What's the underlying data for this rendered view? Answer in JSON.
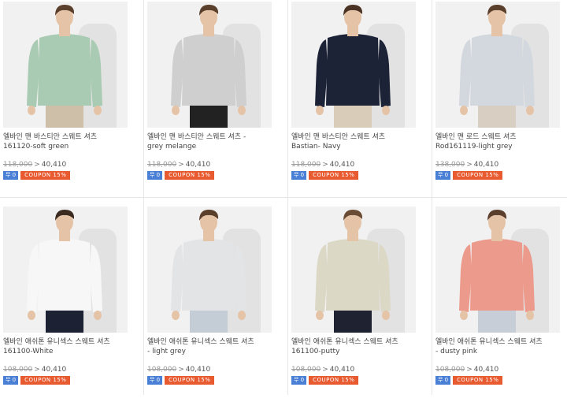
{
  "products": [
    {
      "title_lines": [
        "엘바인 맨 바스티안 스웨트 셔츠",
        "161120-soft green"
      ],
      "old_price": "118,000",
      "new_price": "40,410",
      "free_badge": "무 0",
      "coupon": "COUPON 15%",
      "colors": {
        "top": "#a9cbb3",
        "pants": "#cdbfa8",
        "skin": "#e5c3a6",
        "hair": "#5a3f2c"
      }
    },
    {
      "title_lines": [
        "엘바인 맨 바스티안 스웨트 셔츠 -",
        "grey melange"
      ],
      "old_price": "118,000",
      "new_price": "40,410",
      "free_badge": "무 0",
      "coupon": "COUPON 15%",
      "colors": {
        "top": "#cfcfcf",
        "pants": "#222222",
        "skin": "#e5c3a6",
        "hair": "#5a3f2c"
      }
    },
    {
      "title_lines": [
        "엘바인 맨 바스티안 스웨트 셔츠",
        "Bastian- Navy"
      ],
      "old_price": "118,000",
      "new_price": "40,410",
      "free_badge": "무 0",
      "coupon": "COUPON 15%",
      "colors": {
        "top": "#1d2337",
        "pants": "#d9cdb9",
        "skin": "#e5c3a6",
        "hair": "#4a3324"
      }
    },
    {
      "title_lines": [
        "엘바인 맨 로드 스웨트 셔츠",
        "Rod161119-light grey"
      ],
      "old_price": "138,000",
      "new_price": "40,410",
      "free_badge": "무 0",
      "coupon": "COUPON 15%",
      "colors": {
        "top": "#d3d8de",
        "pants": "#d8cfc2",
        "skin": "#e5c3a6",
        "hair": "#5a3f2c"
      }
    },
    {
      "title_lines": [
        "엘바인 애쉬톤 유니섹스 스웨트 셔츠",
        "161100-White"
      ],
      "old_price": "108,000",
      "new_price": "40,410",
      "free_badge": "무 0",
      "coupon": "COUPON 15%",
      "colors": {
        "top": "#f7f7f7",
        "pants": "#1c2233",
        "skin": "#e5c3a6",
        "hair": "#3a2a20"
      }
    },
    {
      "title_lines": [
        "엘바인 애쉬톤 유니섹스 스웨트 셔츠",
        "- light grey"
      ],
      "old_price": "108,000",
      "new_price": "40,410",
      "free_badge": "무 0",
      "coupon": "COUPON 15%",
      "colors": {
        "top": "#e3e4e6",
        "pants": "#c4ccd6",
        "skin": "#e5c3a6",
        "hair": "#5a3f2c"
      }
    },
    {
      "title_lines": [
        "엘바인 애쉬톤 유니섹스 스웨트 셔츠",
        "161100-putty"
      ],
      "old_price": "108,000",
      "new_price": "40,410",
      "free_badge": "무 0",
      "coupon": "COUPON 15%",
      "colors": {
        "top": "#dcd8c6",
        "pants": "#1f2230",
        "skin": "#e5c3a6",
        "hair": "#6a4c34"
      }
    },
    {
      "title_lines": [
        "엘바인 애쉬톤 유니섹스 스웨트 셔츠",
        "- dusty pink"
      ],
      "old_price": "108,000",
      "new_price": "40,410",
      "free_badge": "무 0",
      "coupon": "COUPON 15%",
      "colors": {
        "top": "#ec9a8c",
        "pants": "#c7ced8",
        "skin": "#e5c3a6",
        "hair": "#5a3f2c"
      }
    }
  ]
}
